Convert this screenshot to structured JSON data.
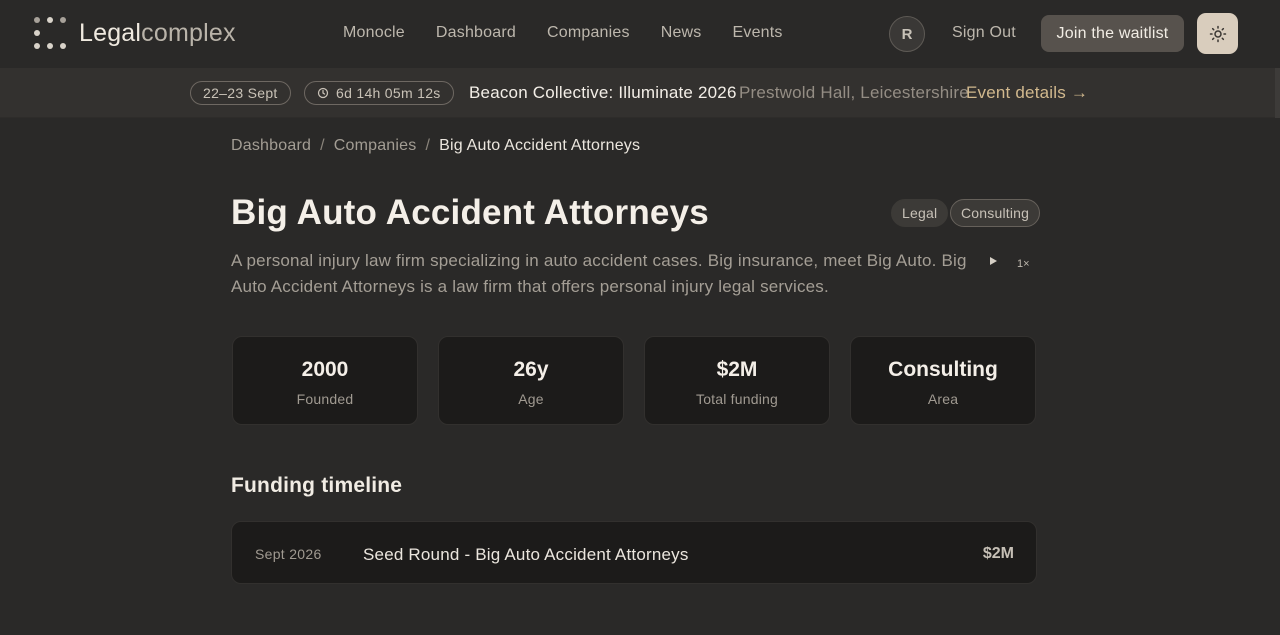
{
  "header": {
    "logo": {
      "bold": "Legal",
      "light": "complex"
    },
    "nav": [
      {
        "label": "Monocle"
      },
      {
        "label": "Dashboard"
      },
      {
        "label": "Companies"
      },
      {
        "label": "News"
      },
      {
        "label": "Events"
      }
    ],
    "avatar_initial": "R",
    "sign_out": "Sign Out",
    "waitlist": "Join the waitlist",
    "theme_icon": "sun-icon"
  },
  "banner": {
    "date": "22–23 Sept",
    "countdown": "6d 14h 05m 12s",
    "event_name": "Beacon Collective: Illuminate 2026",
    "location": "Prestwold Hall, Leicestershire",
    "link": "Event details →"
  },
  "breadcrumb": {
    "items": [
      "Dashboard",
      "Companies"
    ],
    "current": "Big Auto Accident Attorneys",
    "separator": "/"
  },
  "company": {
    "name": "Big Auto Accident Attorneys",
    "tags": [
      "Legal",
      "Consulting"
    ],
    "description": "A personal injury law firm specializing in auto accident cases. Big insurance, meet Big Auto. Big Auto Accident Attorneys is a law firm that offers personal injury legal services.",
    "playback_speed": "1×"
  },
  "stats": [
    {
      "value": "2000",
      "label": "Founded"
    },
    {
      "value": "26y",
      "label": "Age"
    },
    {
      "value": "$2M",
      "label": "Total funding"
    },
    {
      "value": "Consulting",
      "label": "Area"
    }
  ],
  "funding": {
    "title": "Funding timeline",
    "rows": [
      {
        "date": "Sept 2026",
        "name": "Seed Round - Big Auto Accident Attorneys",
        "amount": "$2M"
      }
    ]
  },
  "colors": {
    "background": "#2a2928",
    "accent": "#d2b98e",
    "card": "#1c1b1a"
  }
}
